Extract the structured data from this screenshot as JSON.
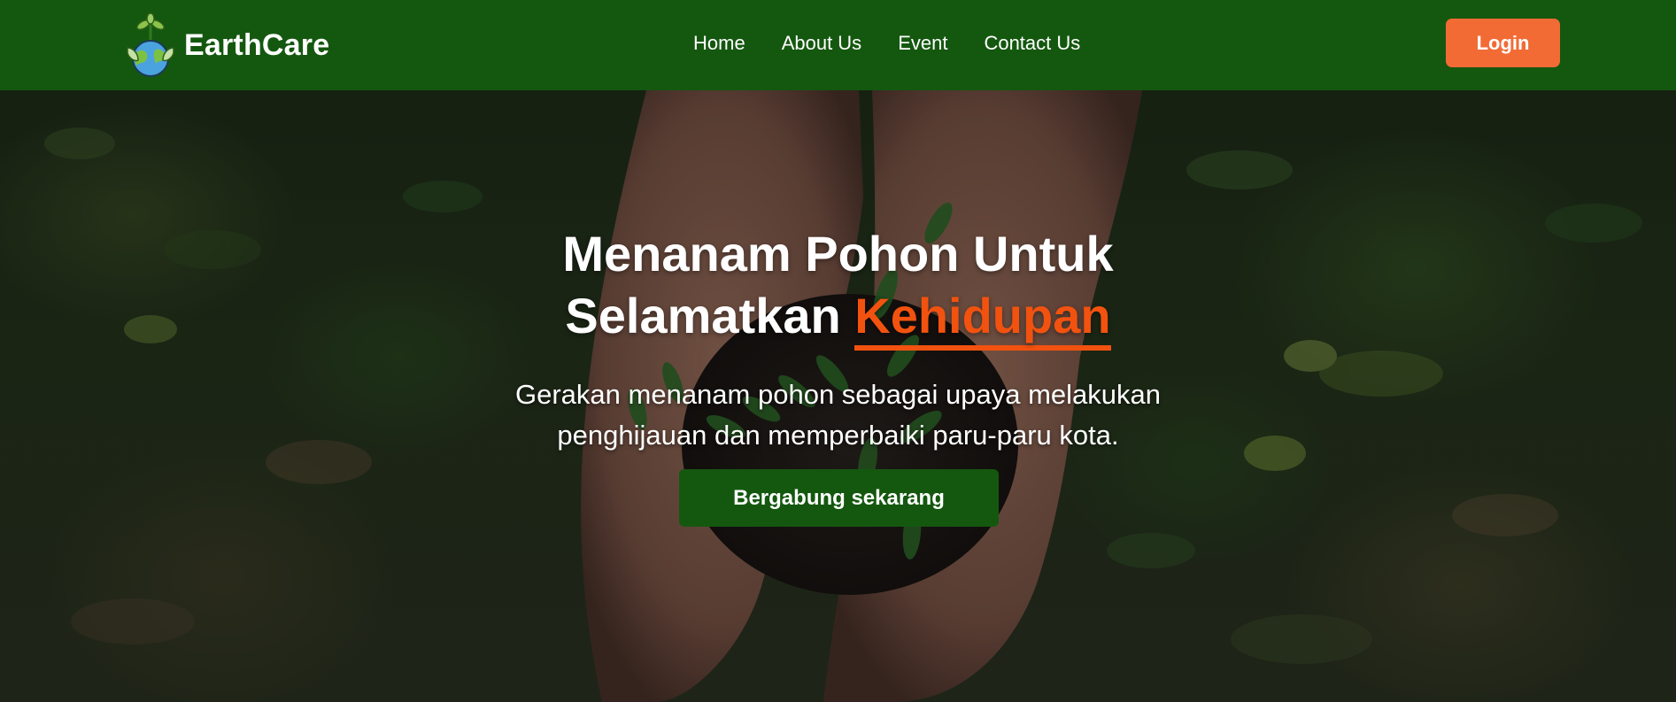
{
  "brand": {
    "name": "EarthCare"
  },
  "nav": {
    "links": [
      {
        "label": "Home"
      },
      {
        "label": "About Us"
      },
      {
        "label": "Event"
      },
      {
        "label": "Contact Us"
      }
    ],
    "login_label": "Login"
  },
  "hero": {
    "title_line1": "Menanam Pohon Untuk",
    "title_line2_prefix": "Selamatkan",
    "title_accent": "Kehidupan",
    "subtitle_line1": "Gerakan menanam pohon sebagai upaya melakukan",
    "subtitle_line2": "penghijauan dan memperbaiki paru-paru kota.",
    "cta_label": "Bergabung sekarang"
  },
  "colors": {
    "navbar": "#14580f",
    "login_button": "#f26b35",
    "accent_text": "#f2520f",
    "cta_button": "#14580f"
  },
  "icons": {
    "logo": "earth-with-sprout-icon"
  }
}
